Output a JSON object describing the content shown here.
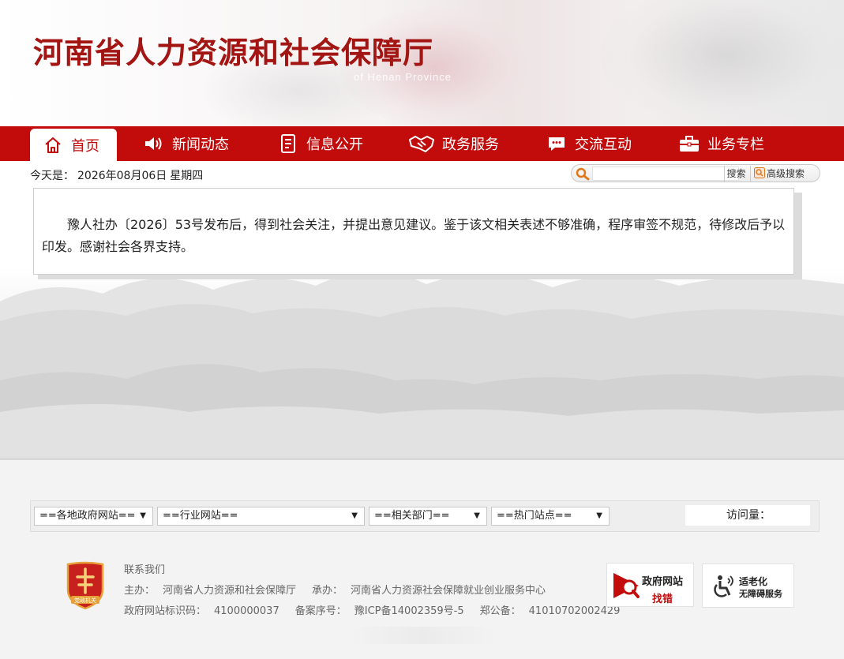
{
  "header": {
    "title": "河南省人力资源和社会保障厅",
    "subtitle": "of Henan Province"
  },
  "nav": {
    "items": [
      {
        "label": "首页",
        "icon": "home-icon",
        "active": true
      },
      {
        "label": "新闻动态",
        "icon": "speaker-icon"
      },
      {
        "label": "信息公开",
        "icon": "document-icon"
      },
      {
        "label": "政务服务",
        "icon": "handshake-icon"
      },
      {
        "label": "交流互动",
        "icon": "chat-icon"
      },
      {
        "label": "业务专栏",
        "icon": "briefcase-icon"
      }
    ]
  },
  "date": {
    "label": "今天是：",
    "date": "2026年08月06日",
    "weekday": "星期四"
  },
  "search": {
    "placeholder": "",
    "button": "搜索",
    "advanced": "高级搜索"
  },
  "notice": {
    "text": "豫人社办〔2026〕53号发布后，得到社会关注，并提出意见建议。鉴于该文相关表述不够准确，程序审签不规范，待修改后予以印发。感谢社会各界支持。"
  },
  "links": {
    "selects": [
      {
        "label": "==各地政府网站=="
      },
      {
        "label": "==行业网站=="
      },
      {
        "label": "==相关部门=="
      },
      {
        "label": "==热门站点=="
      }
    ],
    "visits_label": "访问量："
  },
  "footer": {
    "contact": "联系我们",
    "host_label": "主办：",
    "host": "河南省人力资源和社会保障厅",
    "undertaker_label": "承办：",
    "undertaker": "河南省人力资源社会保障就业创业服务中心",
    "site_id_label": "政府网站标识码：",
    "site_id": "4100000037",
    "icp_label": "备案序号：",
    "icp": "豫ICP备14002359号-5",
    "police_label": "郑公备：",
    "police": "41010702002429",
    "emblem_text": "党政机关",
    "badge_error_line1": "政府网站",
    "badge_error_line2": "找错",
    "badge_access_line1": "适老化",
    "badge_access_line2": "无障碍服务"
  },
  "colors": {
    "brand_red": "#c20c0c",
    "title_red": "#a31513"
  }
}
